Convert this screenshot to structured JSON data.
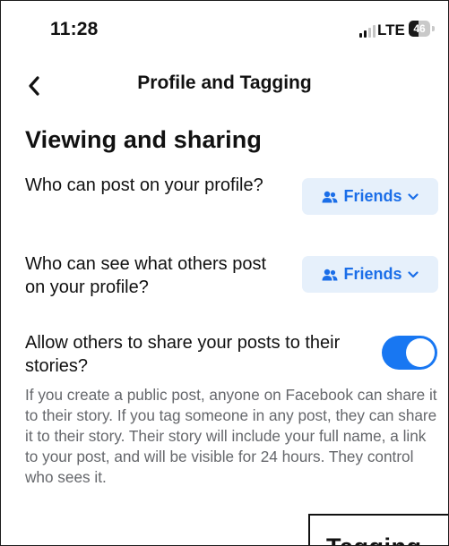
{
  "status_bar": {
    "time": "11:28",
    "network": "LTE",
    "battery_level": "46",
    "battery_fraction": 0.46,
    "signal_icon": "signal-bars-icon",
    "battery_icon": "battery-icon"
  },
  "header": {
    "title": "Profile and Tagging",
    "back_icon": "chevron-left-icon"
  },
  "section": {
    "heading": "Viewing and sharing"
  },
  "settings": {
    "post_on_profile": {
      "label": "Who can post on your profile?",
      "audience": "Friends"
    },
    "see_others_posts": {
      "label": "Who can see what others post on your profile?",
      "audience": "Friends"
    },
    "share_to_stories": {
      "label": "Allow others to share your posts to their stories?",
      "enabled": true,
      "description": "If you create a public post, anyone on Facebook can share it to their story. If you tag someone in any post, they can share it to their story. Their story will include your full name, a link to your post, and will be visible for 24 hours. They control who sees it."
    }
  },
  "next_section": {
    "title": "Tagging"
  },
  "colors": {
    "accent": "#1877f2",
    "audience_button_bg": "#e6f0fb",
    "audience_button_text": "#1b6ee8",
    "description_text": "#65676b"
  }
}
